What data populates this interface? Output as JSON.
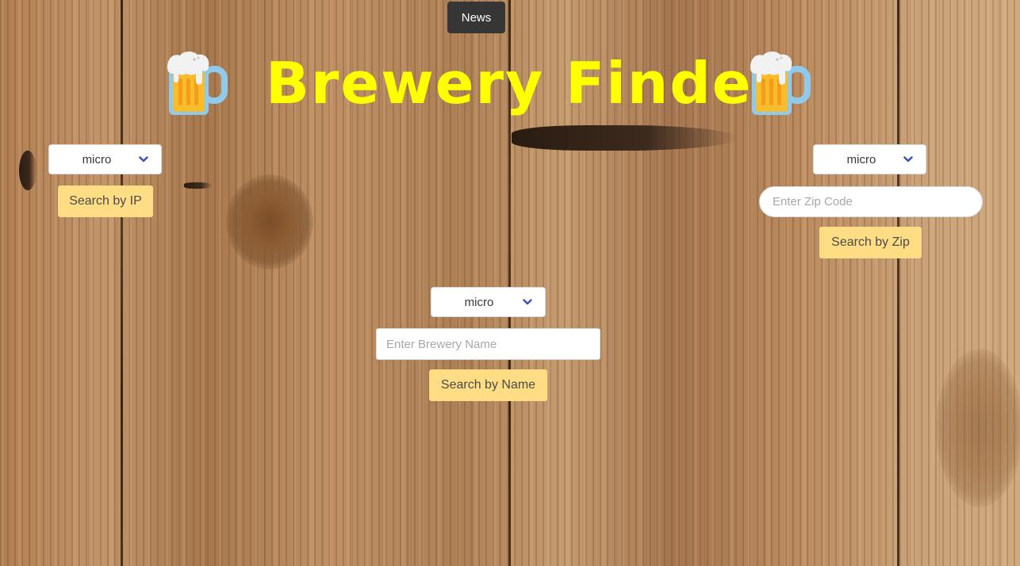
{
  "header": {
    "news_label": "News",
    "title": "Brewery Finder",
    "title_color": "#ffff00",
    "decor_icon": "beer-mug-icon"
  },
  "ip_search": {
    "type_select": "micro",
    "button_label": "Search by IP"
  },
  "zip_search": {
    "type_select": "micro",
    "input_value": "",
    "input_placeholder": "Enter Zip Code",
    "button_label": "Search by Zip"
  },
  "name_search": {
    "type_select": "micro",
    "input_value": "",
    "input_placeholder": "Enter Brewery Name",
    "button_label": "Search by Name"
  },
  "colors": {
    "button_bg": "#ffdd85",
    "news_bg": "#363636",
    "chevron": "#3850b7",
    "background": "wood-planks"
  }
}
